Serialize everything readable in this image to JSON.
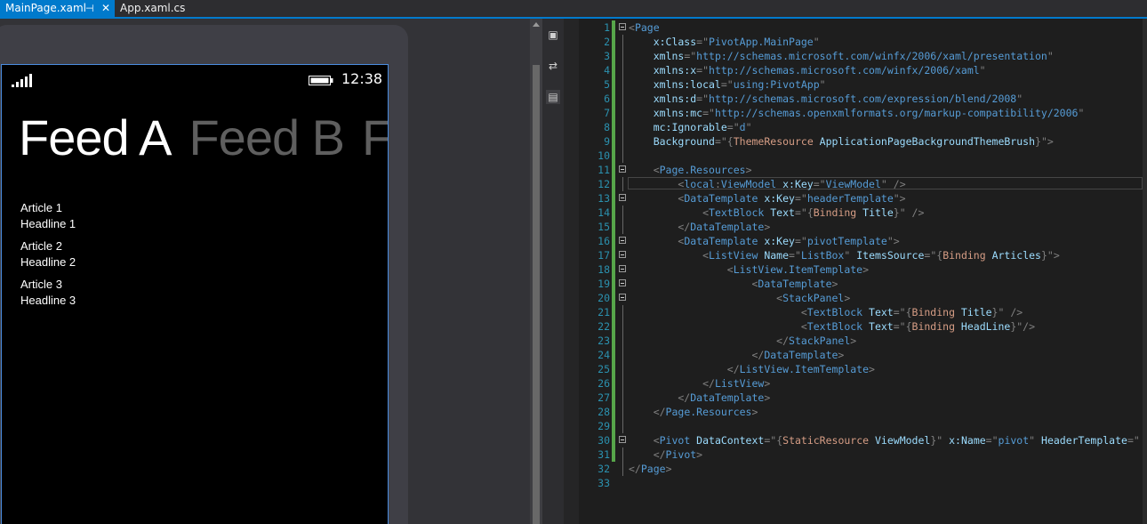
{
  "tabs": [
    {
      "label": "MainPage.xaml",
      "active": true
    },
    {
      "label": "App.xaml.cs",
      "active": false
    }
  ],
  "phone": {
    "clock": "12:38",
    "pivot_headers": [
      "Feed A",
      "Feed B",
      "Feed C"
    ],
    "articles": [
      {
        "title": "Article 1",
        "headline": "Headline 1"
      },
      {
        "title": "Article 2",
        "headline": "Headline 2"
      },
      {
        "title": "Article 3",
        "headline": "Headline 3"
      }
    ]
  },
  "editor": {
    "current_line": 12,
    "lines": [
      {
        "n": "1",
        "tokens": [
          [
            "<",
            "punc"
          ],
          [
            "Page",
            "tag"
          ]
        ]
      },
      {
        "n": "2",
        "tokens": [
          [
            "    x:Class",
            "attr"
          ],
          [
            "=\"",
            "punc"
          ],
          [
            "PivotApp.MainPage",
            "tag"
          ],
          [
            "\"",
            "punc"
          ]
        ]
      },
      {
        "n": "3",
        "tokens": [
          [
            "    xmlns",
            "attr"
          ],
          [
            "=\"",
            "punc"
          ],
          [
            "http://schemas.microsoft.com/winfx/2006/xaml/presentation",
            "tag"
          ],
          [
            "\"",
            "punc"
          ]
        ]
      },
      {
        "n": "4",
        "tokens": [
          [
            "    xmlns:x",
            "attr"
          ],
          [
            "=\"",
            "punc"
          ],
          [
            "http://schemas.microsoft.com/winfx/2006/xaml",
            "tag"
          ],
          [
            "\"",
            "punc"
          ]
        ]
      },
      {
        "n": "5",
        "tokens": [
          [
            "    xmlns:local",
            "attr"
          ],
          [
            "=\"",
            "punc"
          ],
          [
            "using:PivotApp",
            "tag"
          ],
          [
            "\"",
            "punc"
          ]
        ]
      },
      {
        "n": "6",
        "tokens": [
          [
            "    xmlns:d",
            "attr"
          ],
          [
            "=\"",
            "punc"
          ],
          [
            "http://schemas.microsoft.com/expression/blend/2008",
            "tag"
          ],
          [
            "\"",
            "punc"
          ]
        ]
      },
      {
        "n": "7",
        "tokens": [
          [
            "    xmlns:mc",
            "attr"
          ],
          [
            "=\"",
            "punc"
          ],
          [
            "http://schemas.openxmlformats.org/markup-compatibility/2006",
            "tag"
          ],
          [
            "\"",
            "punc"
          ]
        ]
      },
      {
        "n": "8",
        "tokens": [
          [
            "    mc:Ignorable",
            "attr"
          ],
          [
            "=\"",
            "punc"
          ],
          [
            "d",
            "tag"
          ],
          [
            "\"",
            "punc"
          ]
        ]
      },
      {
        "n": "9",
        "tokens": [
          [
            "    Background",
            "attr"
          ],
          [
            "=\"",
            "punc"
          ],
          [
            "{",
            "punc"
          ],
          [
            "ThemeResource",
            "str"
          ],
          [
            " ApplicationPageBackgroundThemeBrush",
            "attr"
          ],
          [
            "}",
            "punc"
          ],
          [
            "\">",
            "punc"
          ]
        ]
      },
      {
        "n": "10",
        "tokens": []
      },
      {
        "n": "11",
        "tokens": [
          [
            "    <",
            "punc"
          ],
          [
            "Page.Resources",
            "tag"
          ],
          [
            ">",
            "punc"
          ]
        ]
      },
      {
        "n": "12",
        "tokens": [
          [
            "        <",
            "punc"
          ],
          [
            "local",
            "tag"
          ],
          [
            ":",
            "punc"
          ],
          [
            "ViewModel",
            "tag"
          ],
          [
            " x:Key",
            "attr"
          ],
          [
            "=\"",
            "punc"
          ],
          [
            "ViewModel",
            "tag"
          ],
          [
            "\"",
            "punc"
          ],
          [
            " />",
            "punc"
          ]
        ]
      },
      {
        "n": "13",
        "tokens": [
          [
            "        <",
            "punc"
          ],
          [
            "DataTemplate",
            "tag"
          ],
          [
            " x:Key",
            "attr"
          ],
          [
            "=\"",
            "punc"
          ],
          [
            "headerTemplate",
            "tag"
          ],
          [
            "\">",
            "punc"
          ]
        ]
      },
      {
        "n": "14",
        "tokens": [
          [
            "            <",
            "punc"
          ],
          [
            "TextBlock",
            "tag"
          ],
          [
            " Text",
            "attr"
          ],
          [
            "=\"",
            "punc"
          ],
          [
            "{",
            "punc"
          ],
          [
            "Binding",
            "str"
          ],
          [
            " Title",
            "attr"
          ],
          [
            "}",
            "punc"
          ],
          [
            "\" />",
            "punc"
          ]
        ]
      },
      {
        "n": "15",
        "tokens": [
          [
            "        </",
            "punc"
          ],
          [
            "DataTemplate",
            "tag"
          ],
          [
            ">",
            "punc"
          ]
        ]
      },
      {
        "n": "16",
        "tokens": [
          [
            "        <",
            "punc"
          ],
          [
            "DataTemplate",
            "tag"
          ],
          [
            " x:Key",
            "attr"
          ],
          [
            "=\"",
            "punc"
          ],
          [
            "pivotTemplate",
            "tag"
          ],
          [
            "\">",
            "punc"
          ]
        ]
      },
      {
        "n": "17",
        "tokens": [
          [
            "            <",
            "punc"
          ],
          [
            "ListView",
            "tag"
          ],
          [
            " Name",
            "attr"
          ],
          [
            "=\"",
            "punc"
          ],
          [
            "ListBox",
            "tag"
          ],
          [
            "\"",
            "punc"
          ],
          [
            " ItemsSource",
            "attr"
          ],
          [
            "=\"",
            "punc"
          ],
          [
            "{",
            "punc"
          ],
          [
            "Binding",
            "str"
          ],
          [
            " Articles",
            "attr"
          ],
          [
            "}",
            "punc"
          ],
          [
            "\">",
            "punc"
          ]
        ]
      },
      {
        "n": "18",
        "tokens": [
          [
            "                <",
            "punc"
          ],
          [
            "ListView.ItemTemplate",
            "tag"
          ],
          [
            ">",
            "punc"
          ]
        ]
      },
      {
        "n": "19",
        "tokens": [
          [
            "                    <",
            "punc"
          ],
          [
            "DataTemplate",
            "tag"
          ],
          [
            ">",
            "punc"
          ]
        ]
      },
      {
        "n": "20",
        "tokens": [
          [
            "                        <",
            "punc"
          ],
          [
            "StackPanel",
            "tag"
          ],
          [
            ">",
            "punc"
          ]
        ]
      },
      {
        "n": "21",
        "tokens": [
          [
            "                            <",
            "punc"
          ],
          [
            "TextBlock",
            "tag"
          ],
          [
            " Text",
            "attr"
          ],
          [
            "=\"",
            "punc"
          ],
          [
            "{",
            "punc"
          ],
          [
            "Binding",
            "str"
          ],
          [
            " Title",
            "attr"
          ],
          [
            "}",
            "punc"
          ],
          [
            "\" />",
            "punc"
          ]
        ]
      },
      {
        "n": "22",
        "tokens": [
          [
            "                            <",
            "punc"
          ],
          [
            "TextBlock",
            "tag"
          ],
          [
            " Text",
            "attr"
          ],
          [
            "=\"",
            "punc"
          ],
          [
            "{",
            "punc"
          ],
          [
            "Binding",
            "str"
          ],
          [
            " HeadLine",
            "attr"
          ],
          [
            "}",
            "punc"
          ],
          [
            "\"/>",
            "punc"
          ]
        ]
      },
      {
        "n": "23",
        "tokens": [
          [
            "                        </",
            "punc"
          ],
          [
            "StackPanel",
            "tag"
          ],
          [
            ">",
            "punc"
          ]
        ]
      },
      {
        "n": "24",
        "tokens": [
          [
            "                    </",
            "punc"
          ],
          [
            "DataTemplate",
            "tag"
          ],
          [
            ">",
            "punc"
          ]
        ]
      },
      {
        "n": "25",
        "tokens": [
          [
            "                </",
            "punc"
          ],
          [
            "ListView.ItemTemplate",
            "tag"
          ],
          [
            ">",
            "punc"
          ]
        ]
      },
      {
        "n": "26",
        "tokens": [
          [
            "            </",
            "punc"
          ],
          [
            "ListView",
            "tag"
          ],
          [
            ">",
            "punc"
          ]
        ]
      },
      {
        "n": "27",
        "tokens": [
          [
            "        </",
            "punc"
          ],
          [
            "DataTemplate",
            "tag"
          ],
          [
            ">",
            "punc"
          ]
        ]
      },
      {
        "n": "28",
        "tokens": [
          [
            "    </",
            "punc"
          ],
          [
            "Page.Resources",
            "tag"
          ],
          [
            ">",
            "punc"
          ]
        ]
      },
      {
        "n": "29",
        "tokens": []
      },
      {
        "n": "30",
        "tokens": [
          [
            "    <",
            "punc"
          ],
          [
            "Pivot",
            "tag"
          ],
          [
            " DataContext",
            "attr"
          ],
          [
            "=\"",
            "punc"
          ],
          [
            "{",
            "punc"
          ],
          [
            "StaticResource",
            "str"
          ],
          [
            " ViewModel",
            "attr"
          ],
          [
            "}",
            "punc"
          ],
          [
            "\"",
            "punc"
          ],
          [
            " x:Name",
            "attr"
          ],
          [
            "=\"",
            "punc"
          ],
          [
            "pivot",
            "tag"
          ],
          [
            "\"",
            "punc"
          ],
          [
            " HeaderTemplate",
            "attr"
          ],
          [
            "=\"",
            "punc"
          ]
        ]
      },
      {
        "n": "31",
        "tokens": [
          [
            "    </",
            "punc"
          ],
          [
            "Pivot",
            "tag"
          ],
          [
            ">",
            "punc"
          ]
        ]
      },
      {
        "n": "32",
        "tokens": [
          [
            "</",
            "punc"
          ],
          [
            "Page",
            "tag"
          ],
          [
            ">",
            "punc"
          ]
        ]
      },
      {
        "n": "33",
        "tokens": []
      }
    ]
  }
}
